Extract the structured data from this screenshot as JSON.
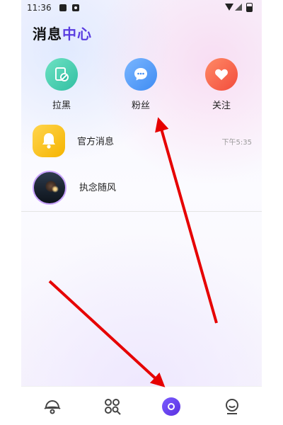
{
  "status_bar": {
    "time": "11:36",
    "icons": [
      "photo-icon",
      "a-icon",
      "wifi-icon",
      "signal-icon",
      "battery-icon"
    ]
  },
  "header": {
    "title_part1": "消息",
    "title_part2": "中心"
  },
  "quick_actions": [
    {
      "label": "拉黑",
      "icon": "block-icon",
      "color": "#3cc9aa"
    },
    {
      "label": "粉丝",
      "icon": "chat-bubble-icon",
      "color": "#4a93f5"
    },
    {
      "label": "关注",
      "icon": "heart-icon",
      "color": "#f5573f"
    }
  ],
  "messages": [
    {
      "name": "官方消息",
      "time": "下午5:35",
      "avatar": "bell-icon"
    },
    {
      "name": "执念随风",
      "time": "",
      "avatar": "user-photo"
    }
  ],
  "bottom_nav": {
    "items": [
      {
        "name": "discover",
        "icon": "planet-icon"
      },
      {
        "name": "square",
        "icon": "grid-search-icon"
      },
      {
        "name": "messages",
        "icon": "message-active-icon",
        "active": true
      },
      {
        "name": "profile",
        "icon": "smile-face-icon"
      }
    ]
  },
  "colors": {
    "accent": "#5a3de0",
    "annotation_arrow": "#e60000"
  }
}
